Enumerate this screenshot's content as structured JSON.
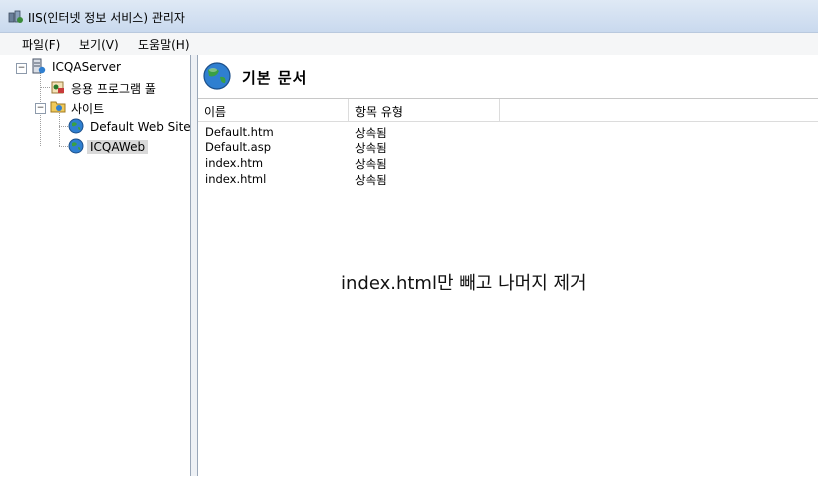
{
  "window": {
    "title": "IIS(인터넷 정보 서비스) 관리자"
  },
  "menu": {
    "items": [
      "파일(F)",
      "보기(V)",
      "도움말(H)"
    ]
  },
  "tree": {
    "server": "ICQAServer",
    "app_pools": "응용 프로그램 풀",
    "sites": "사이트",
    "site1": "Default Web Site",
    "site2": "ICQAWeb"
  },
  "main": {
    "title": "기본 문서",
    "columns": [
      "이름",
      "항목 유형"
    ],
    "rows": [
      [
        "Default.htm",
        "상속됨"
      ],
      [
        "Default.asp",
        "상속됨"
      ],
      [
        "index.htm",
        "상속됨"
      ],
      [
        "index.html",
        "상속됨"
      ]
    ],
    "annotation": "index.html만 빼고 나머지 제거"
  },
  "colors": {
    "title_bar": "#c9d9ee",
    "selection": "#d9d9d9"
  }
}
